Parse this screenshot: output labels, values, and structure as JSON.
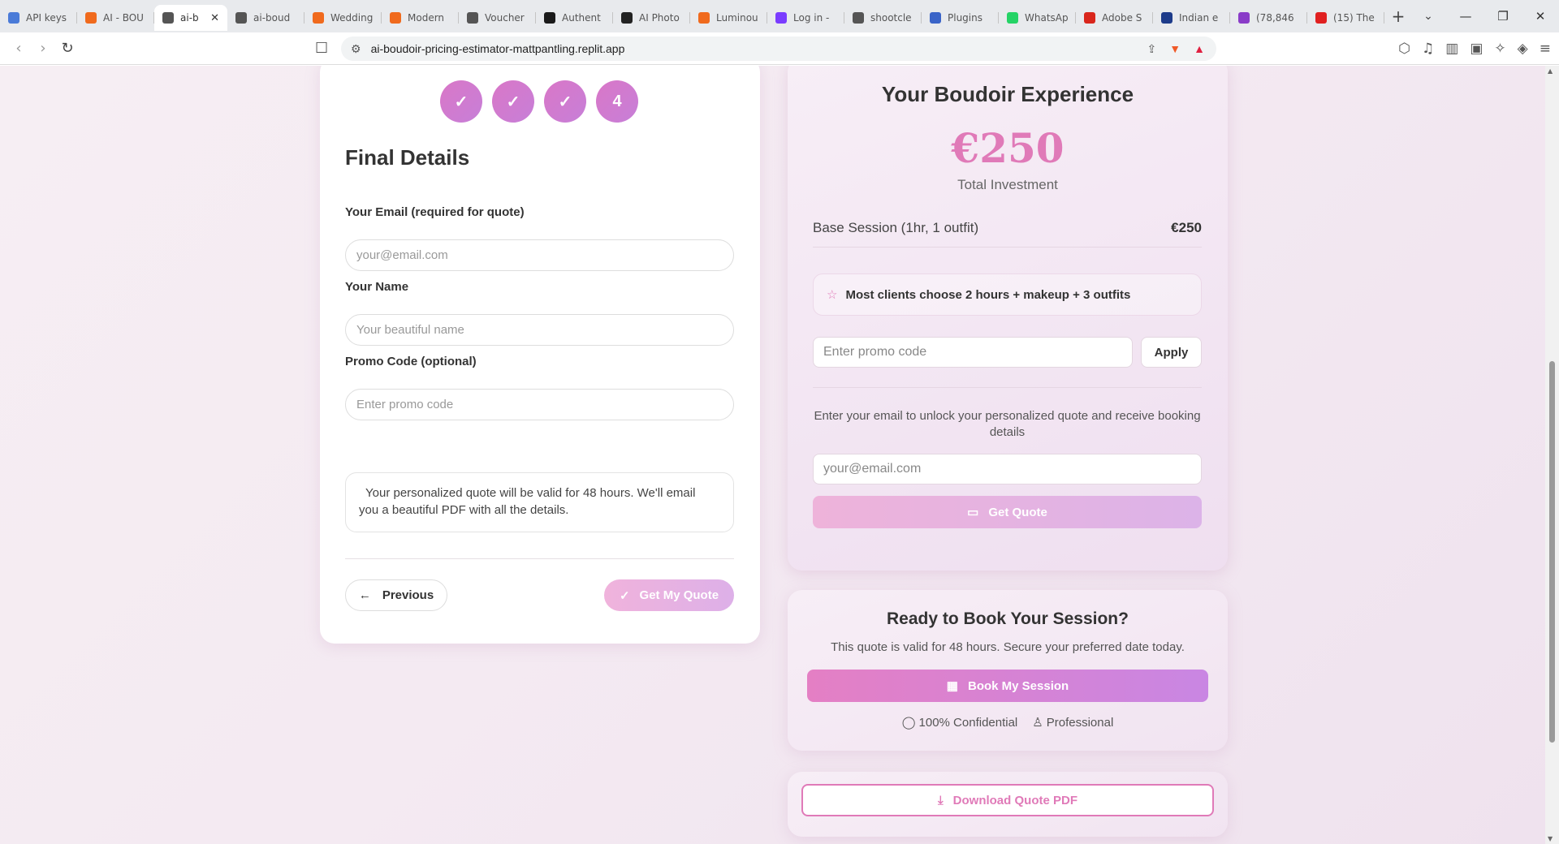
{
  "browser": {
    "tabs": [
      {
        "title": "API keys",
        "color": "#4a7bd8"
      },
      {
        "title": "AI - BOU",
        "color": "#f06a1d"
      },
      {
        "title": "ai-b",
        "color": "#555555",
        "active": true
      },
      {
        "title": "ai-boud",
        "color": "#555555"
      },
      {
        "title": "Wedding",
        "color": "#f06a1d"
      },
      {
        "title": "Modern",
        "color": "#f06a1d"
      },
      {
        "title": "Voucher",
        "color": "#555555"
      },
      {
        "title": "Authent",
        "color": "#1a1a1a"
      },
      {
        "title": "AI Photo",
        "color": "#222222"
      },
      {
        "title": "Luminou",
        "color": "#f06a1d"
      },
      {
        "title": "Log in -",
        "color": "#7a3cff"
      },
      {
        "title": "shootcle",
        "color": "#555555"
      },
      {
        "title": "Plugins",
        "color": "#3a64c8"
      },
      {
        "title": "WhatsAp",
        "color": "#25d366"
      },
      {
        "title": "Adobe S",
        "color": "#d9261c"
      },
      {
        "title": "Indian e",
        "color": "#1d3b8a"
      },
      {
        "title": "(78,846",
        "color": "#8a3cc8"
      },
      {
        "title": "(15) The",
        "color": "#e02020"
      }
    ],
    "new_tab": "+",
    "url": "ai-boudoir-pricing-estimator-mattpantling.replit.app"
  },
  "form": {
    "steps": [
      "✓",
      "✓",
      "✓",
      "4"
    ],
    "title": "Final Details",
    "email_label": "Your Email (required for quote)",
    "email_placeholder": "your@email.com",
    "name_label": "Your Name",
    "name_placeholder": "Your beautiful name",
    "promo_label": "Promo Code (optional)",
    "promo_placeholder": "Enter promo code",
    "notice": "Your personalized quote will be valid for 48 hours. We'll email you a beautiful PDF with all the details.",
    "previous": "Previous",
    "get_my_quote": "Get My Quote"
  },
  "summary": {
    "title": "Your Boudoir Experience",
    "price": "€250",
    "price_label": "Total Investment",
    "line_label": "Base Session (1hr, 1 outfit)",
    "line_amount": "€250",
    "tip": "Most clients choose 2 hours + makeup + 3 outfits",
    "promo_placeholder": "Enter promo code",
    "apply": "Apply",
    "unlock_text": "Enter your email to unlock your personalized quote and receive booking details",
    "email_placeholder": "your@email.com",
    "get_quote": "Get Quote"
  },
  "booking": {
    "title": "Ready to Book Your Session?",
    "subtitle": "This quote is valid for 48 hours. Secure your preferred date today.",
    "button": "Book My Session",
    "badge_confidential": "100% Confidential",
    "badge_professional": "Professional"
  },
  "download": {
    "button": "Download Quote PDF"
  },
  "colors": {
    "accent": "#e07ab8",
    "accent2": "#c77fd8"
  }
}
